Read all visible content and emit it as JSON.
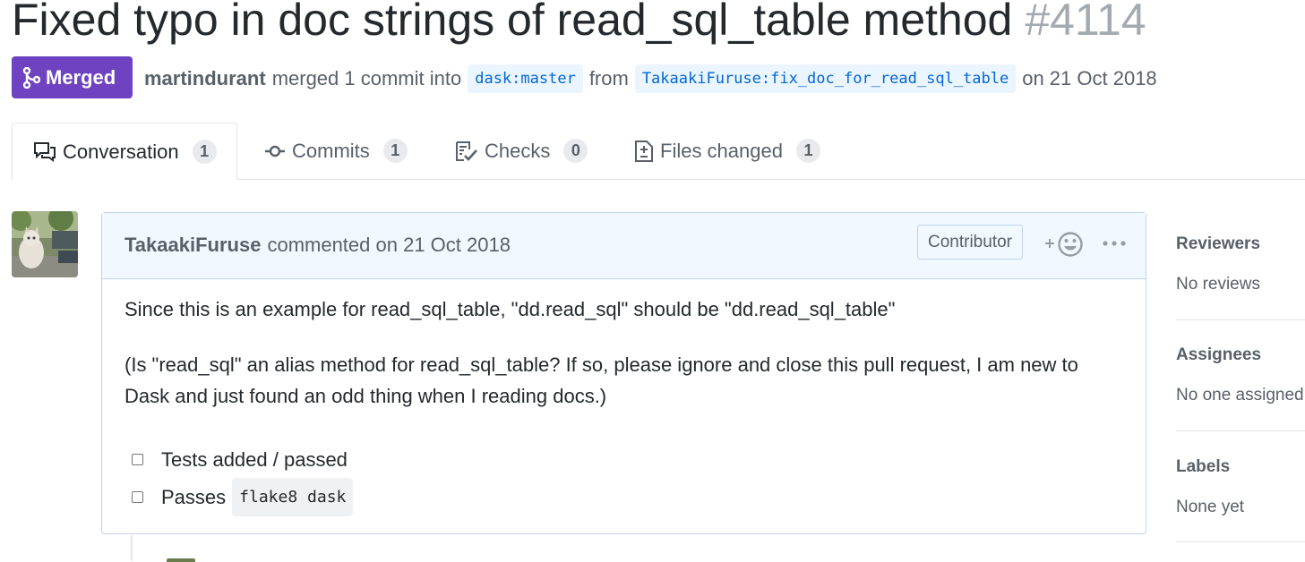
{
  "pr": {
    "title": "Fixed typo in doc strings of read_sql_table method",
    "number": "#4114",
    "state_label": "Merged",
    "author": "martindurant",
    "action_text": "merged 1 commit into",
    "base_branch": "dask:master",
    "from_text": "from",
    "head_branch": "TakaakiFuruse:fix_doc_for_read_sql_table",
    "date_text": "on 21 Oct 2018"
  },
  "tabs": [
    {
      "label": "Conversation",
      "count": "1",
      "icon": "comment-discussion-icon"
    },
    {
      "label": "Commits",
      "count": "1",
      "icon": "git-commit-icon"
    },
    {
      "label": "Checks",
      "count": "0",
      "icon": "checklist-icon"
    },
    {
      "label": "Files changed",
      "count": "1",
      "icon": "diff-icon"
    }
  ],
  "comment": {
    "author": "TakaakiFuruse",
    "action": "commented on 21 Oct 2018",
    "role_badge": "Contributor",
    "reaction_plus": "+",
    "paragraph1": "Since this is an example for read_sql_table, \"dd.read_sql\" should be \"dd.read_sql_table\"",
    "paragraph2": "(Is \"read_sql\" an alias method for read_sql_table? If so, please ignore and close this pull request, I am new to Dask and just found an odd thing when I reading docs.)",
    "tasks": [
      {
        "label": "Tests added / passed",
        "code": "",
        "checked": false
      },
      {
        "label": "Passes",
        "code": "flake8 dask",
        "checked": false
      }
    ]
  },
  "sidebar": {
    "reviewers": {
      "title": "Reviewers",
      "value": "No reviews"
    },
    "assignees": {
      "title": "Assignees",
      "value": "No one assigned"
    },
    "labels": {
      "title": "Labels",
      "value": "None yet"
    }
  },
  "colors": {
    "merged": "#6f42c1",
    "link": "#0366d6",
    "branch_bg": "#eaf5ff",
    "comment_header_bg": "#f1f8ff",
    "comment_border": "#c0d3eb"
  }
}
